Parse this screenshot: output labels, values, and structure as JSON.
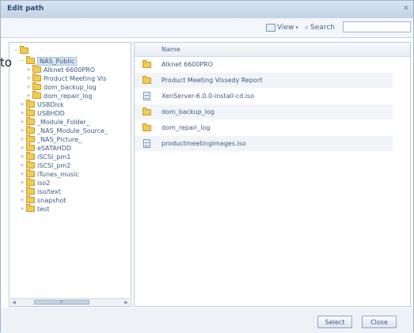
{
  "window": {
    "title": "Edit path"
  },
  "toolbar": {
    "view_label": "View",
    "search_label": "Search",
    "search_value": ""
  },
  "overlay_text": "to",
  "tree": {
    "root_label": "",
    "nodes": [
      {
        "label": "NAS_Public",
        "level": 1,
        "expander": "−",
        "selected": true
      },
      {
        "label": "Alknet 6600PRO",
        "level": 2,
        "expander": "+"
      },
      {
        "label": "Product Meeting Vis",
        "level": 2,
        "expander": "+"
      },
      {
        "label": "dom_backup_log",
        "level": 2,
        "expander": "+"
      },
      {
        "label": "dom_repair_log",
        "level": 2,
        "expander": "+"
      },
      {
        "label": "USBDisk",
        "level": 1,
        "expander": "+"
      },
      {
        "label": "USBHDD",
        "level": 1,
        "expander": "+"
      },
      {
        "label": "_Module_Folder_",
        "level": 1,
        "expander": "+"
      },
      {
        "label": "_NAS_Module_Source_",
        "level": 1,
        "expander": "+"
      },
      {
        "label": "_NAS_Picture_",
        "level": 1,
        "expander": "+"
      },
      {
        "label": "eSATAHDD",
        "level": 1,
        "expander": "+"
      },
      {
        "label": "iSCSI_pm1",
        "level": 1,
        "expander": "+"
      },
      {
        "label": "iSCSI_pm2",
        "level": 1,
        "expander": "+"
      },
      {
        "label": "iTunes_music",
        "level": 1,
        "expander": "+"
      },
      {
        "label": "iso2",
        "level": 1,
        "expander": "+"
      },
      {
        "label": "iso/text",
        "level": 1,
        "expander": "+"
      },
      {
        "label": "snapshot",
        "level": 1,
        "expander": "+"
      },
      {
        "label": "test",
        "level": 1,
        "expander": "+"
      }
    ]
  },
  "list": {
    "column_name": "Name",
    "items": [
      {
        "name": "Alknet 6600PRO",
        "type": "folder"
      },
      {
        "name": "Product Meeting Vissedy Report",
        "type": "folder"
      },
      {
        "name": "XenServer-6.0.0-install-cd.iso",
        "type": "file"
      },
      {
        "name": "dom_backup_log",
        "type": "folder"
      },
      {
        "name": "dom_repair_log",
        "type": "folder"
      },
      {
        "name": "productmeetingimages.iso",
        "type": "file"
      }
    ]
  },
  "buttons": {
    "select_label": "Select",
    "close_label": "Close"
  }
}
